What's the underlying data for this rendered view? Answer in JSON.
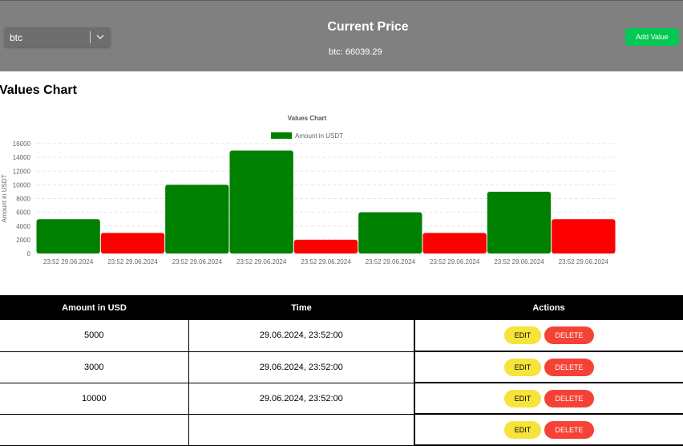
{
  "header": {
    "select_value": "btc",
    "title": "Current Price",
    "price_text": "btc: 66039.29",
    "add_button": "Add Value"
  },
  "section_title": "Values Chart",
  "chart_data": {
    "type": "bar",
    "title": "Values Chart",
    "ylabel": "Amount in USDT",
    "xlabel": "",
    "legend": "Amount in USDT",
    "legend_position": "top",
    "grid": true,
    "ylim": [
      0,
      16000
    ],
    "yticks": [
      0,
      2000,
      4000,
      6000,
      8000,
      10000,
      12000,
      14000,
      16000
    ],
    "categories": [
      "23:52 29.06.2024",
      "23:52 29.06.2024",
      "23:52 29.06.2024",
      "23:52 29.06.2024",
      "23:52 29.06.2024",
      "23:52 29.06.2024",
      "23:52 29.06.2024",
      "23:52 29.06.2024",
      "23:52 29.06.2024"
    ],
    "values": [
      5000,
      3000,
      10000,
      15000,
      2000,
      6000,
      3000,
      9000,
      5000
    ],
    "bar_colors": [
      "#008000",
      "#ff0000",
      "#008000",
      "#008000",
      "#ff0000",
      "#008000",
      "#ff0000",
      "#008000",
      "#ff0000"
    ],
    "legend_color": "#008000"
  },
  "table": {
    "headers": [
      "Amount in USD",
      "Time",
      "Actions"
    ],
    "rows": [
      {
        "amount": "5000",
        "time": "29.06.2024, 23:52:00"
      },
      {
        "amount": "3000",
        "time": "29.06.2024, 23:52:00"
      },
      {
        "amount": "10000",
        "time": "29.06.2024, 23:52:00"
      },
      {
        "amount": "",
        "time": ""
      }
    ],
    "edit_label": "EDIT",
    "delete_label": "DELETE"
  },
  "colors": {
    "header_bg": "#808080",
    "add_button": "#00c853",
    "edit_button": "#f6e33b",
    "delete_button": "#f44336"
  }
}
